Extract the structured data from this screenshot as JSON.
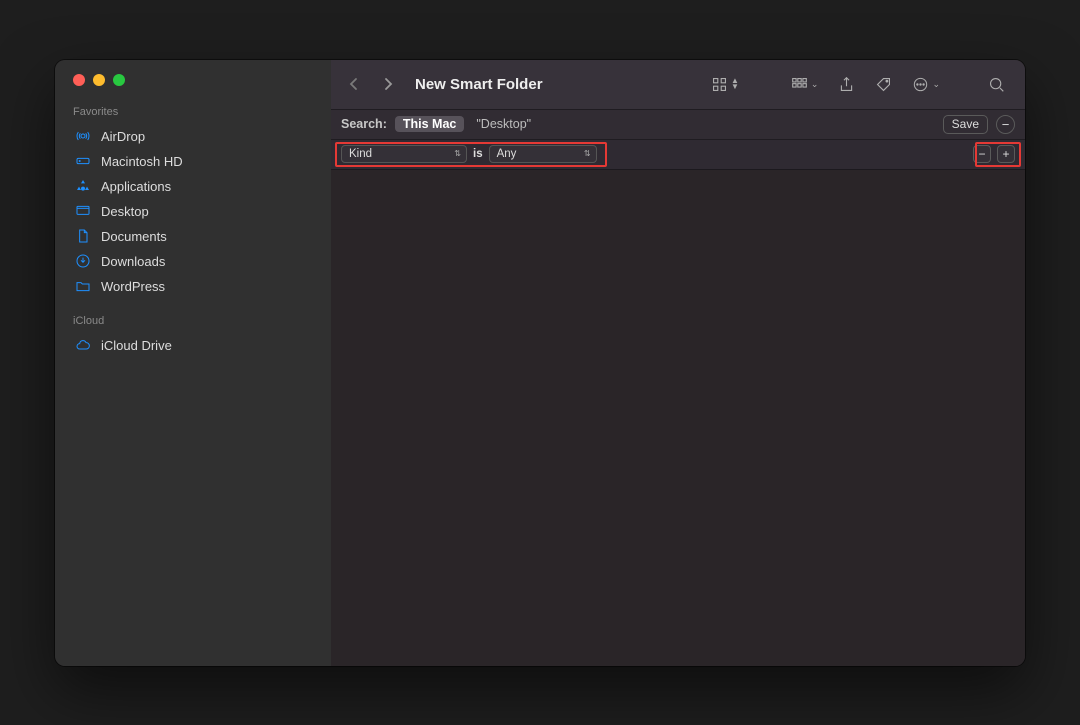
{
  "window_title": "New Smart Folder",
  "sidebar": {
    "sections": [
      {
        "title": "Favorites",
        "items": [
          {
            "icon": "airdrop-icon",
            "label": "AirDrop"
          },
          {
            "icon": "hdd-icon",
            "label": "Macintosh HD"
          },
          {
            "icon": "apps-icon",
            "label": "Applications"
          },
          {
            "icon": "desktop-icon",
            "label": "Desktop"
          },
          {
            "icon": "doc-icon",
            "label": "Documents"
          },
          {
            "icon": "downloads-icon",
            "label": "Downloads"
          },
          {
            "icon": "folder-icon",
            "label": "WordPress"
          }
        ]
      },
      {
        "title": "iCloud",
        "items": [
          {
            "icon": "cloud-icon",
            "label": "iCloud Drive"
          }
        ]
      }
    ]
  },
  "searchbar": {
    "label": "Search:",
    "scope_active": "This Mac",
    "scope_inactive": "\"Desktop\"",
    "save": "Save"
  },
  "criteria": {
    "attribute": "Kind",
    "operator": "is",
    "value": "Any"
  }
}
